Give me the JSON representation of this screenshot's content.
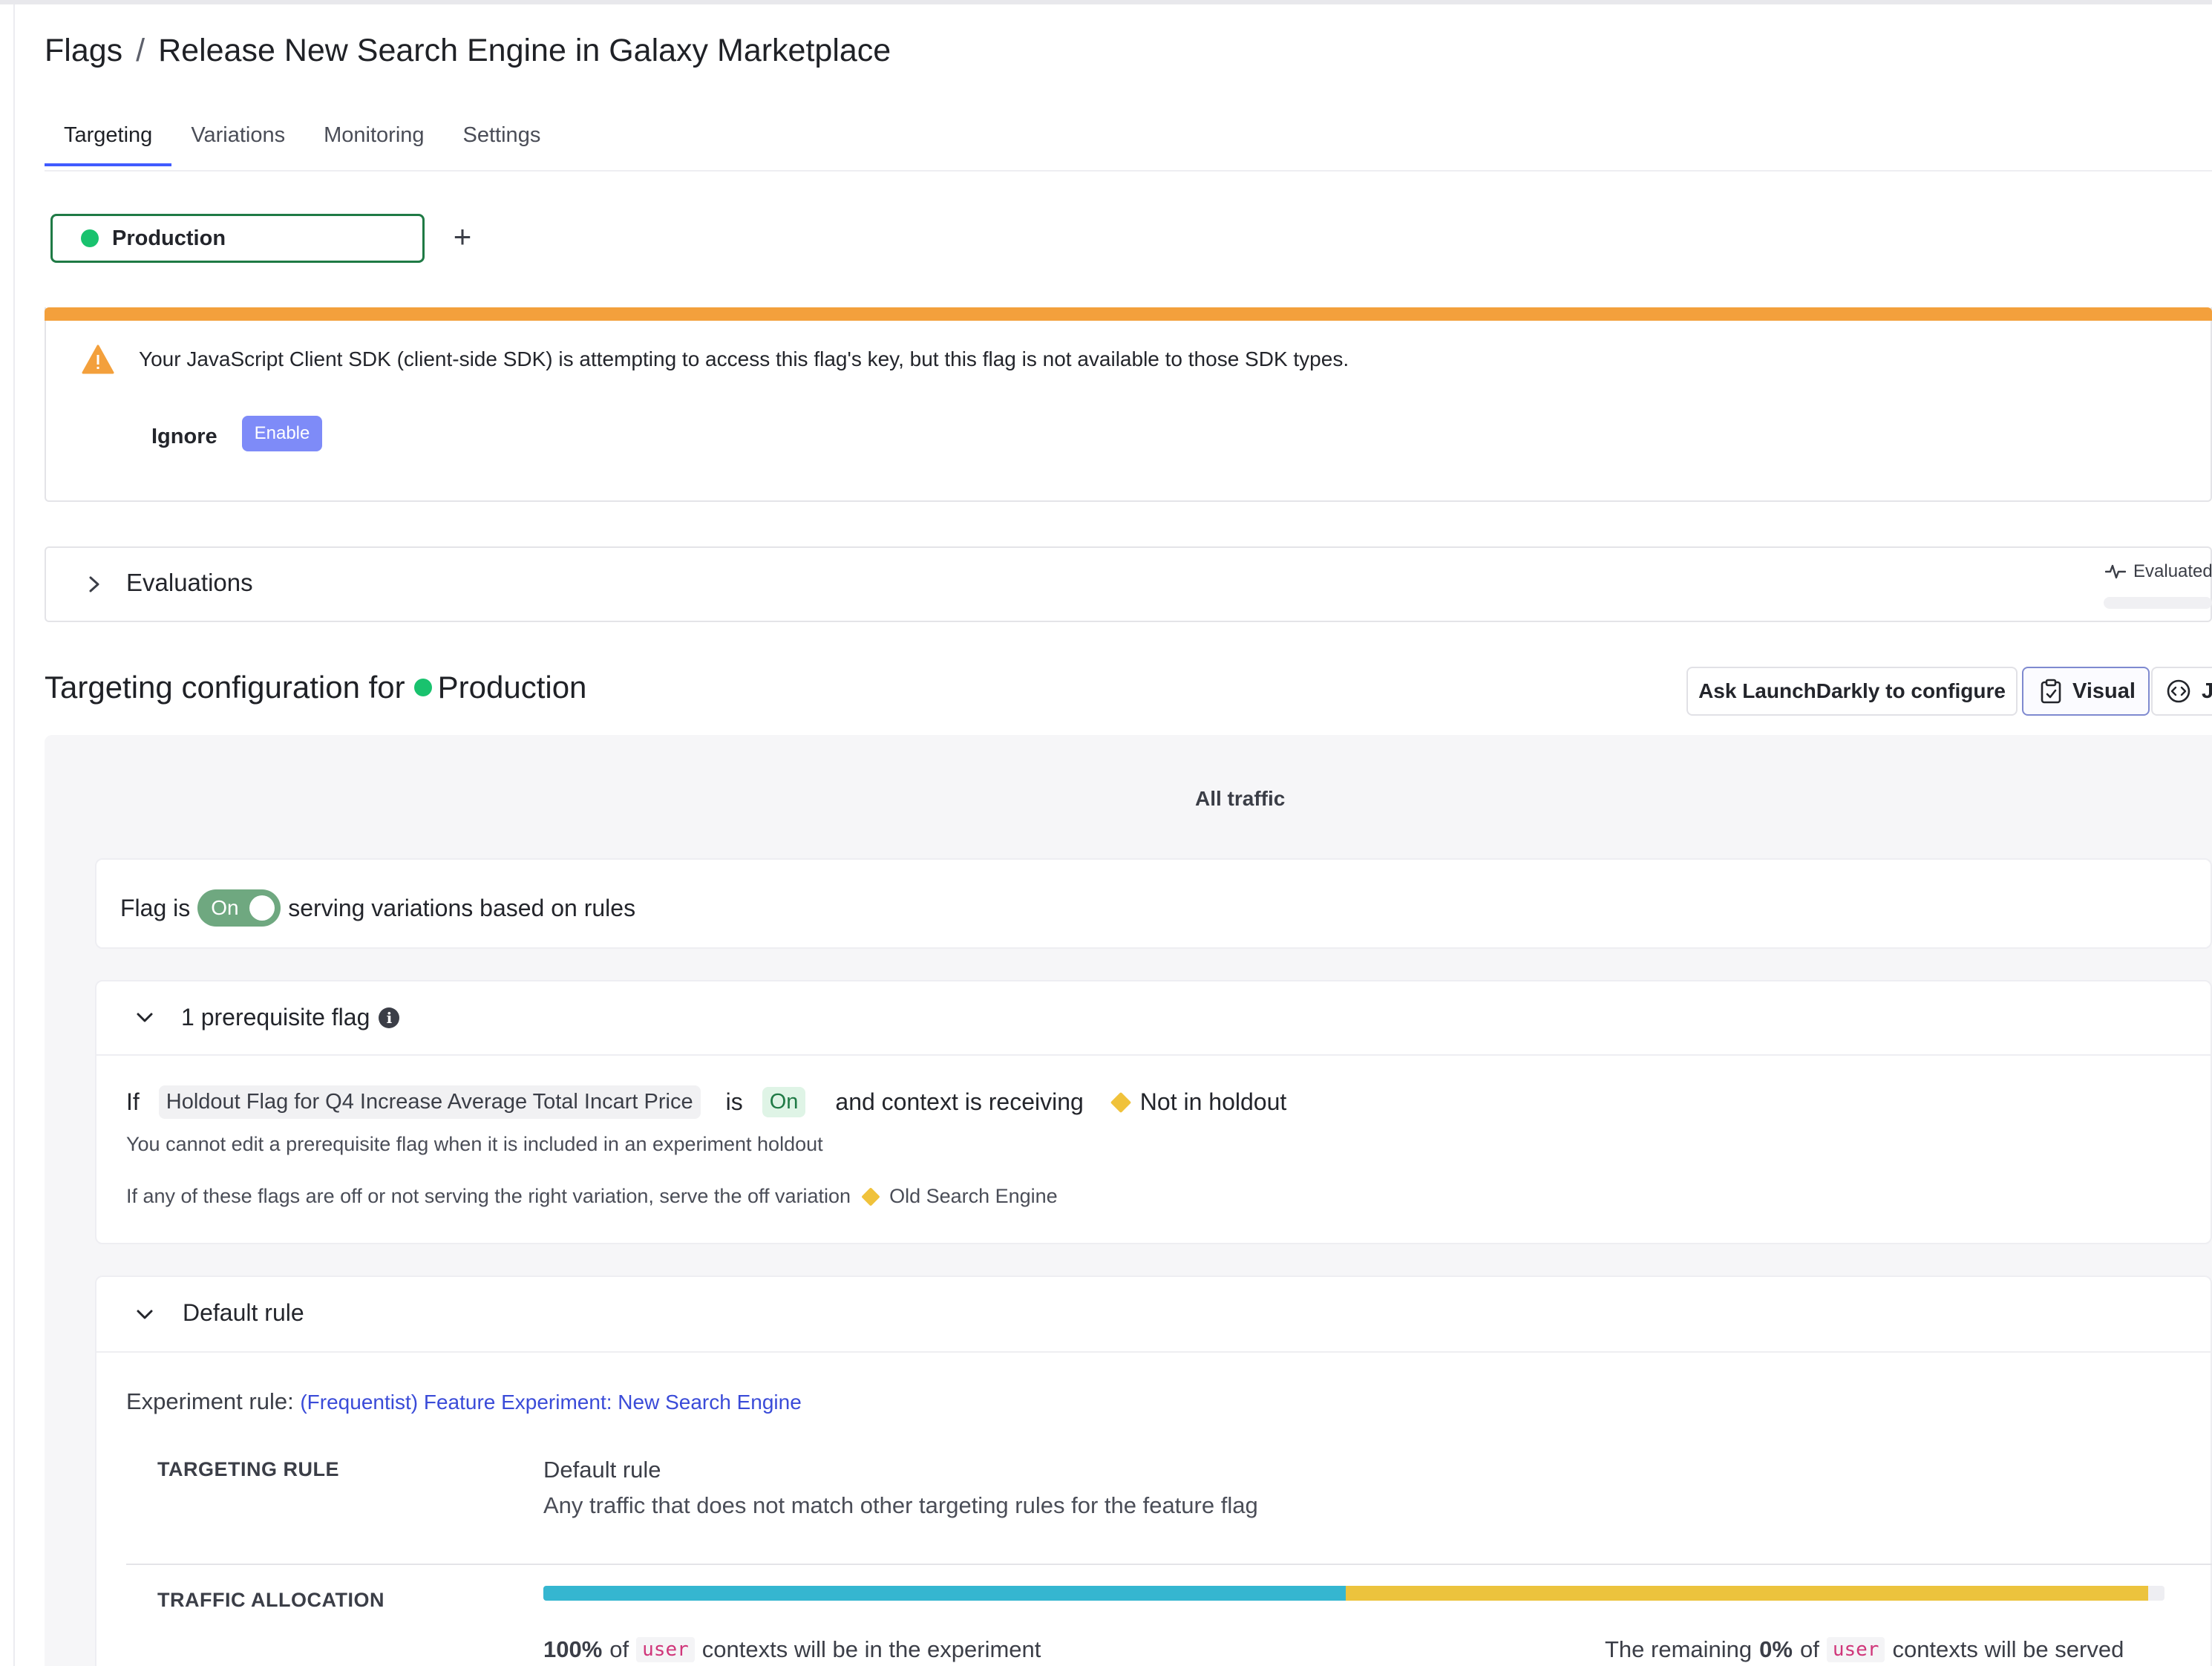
{
  "breadcrumb": {
    "root": "Flags",
    "separator": "/",
    "flag_name": "Release New Search Engine in Galaxy Marketplace"
  },
  "tabs": [
    {
      "label": "Targeting",
      "active": true
    },
    {
      "label": "Variations",
      "active": false
    },
    {
      "label": "Monitoring",
      "active": false
    },
    {
      "label": "Settings",
      "active": false
    }
  ],
  "environment": {
    "name": "Production",
    "color": "#19c26e",
    "add_label": "+"
  },
  "warning": {
    "message": "Your JavaScript Client SDK (client-side SDK) is attempting to access this flag's key, but this flag is not available to those SDK types.",
    "ignore_label": "Ignore",
    "enable_label": "Enable",
    "accent_color": "#f3a03c"
  },
  "evaluations": {
    "label": "Evaluations",
    "status": "Evaluated"
  },
  "targeting_config": {
    "title_prefix": "Targeting configuration for",
    "env_name": "Production",
    "ask_button": "Ask LaunchDarkly to configure",
    "visual_button": "Visual",
    "json_button": "JS"
  },
  "panel": {
    "all_traffic": "All traffic",
    "flag_status": {
      "prefix": "Flag is",
      "toggle_label": "On",
      "suffix": "serving variations based on rules"
    },
    "prerequisites": {
      "title": "1 prerequisite flag",
      "info_icon": "i",
      "if_label": "If",
      "flag_name": "Holdout Flag for Q4 Increase Average Total Incart Price",
      "is_label": "is",
      "state": "On",
      "receiving_label": "and context is receiving",
      "variation": "Not in holdout",
      "note": "You cannot edit a prerequisite flag when it is included in an experiment holdout",
      "off_note": "If any of these flags are off or not serving the right variation, serve the off variation",
      "off_variation": "Old Search Engine"
    },
    "default_rule": {
      "title": "Default rule",
      "experiment_label": "Experiment rule:",
      "experiment_link": "(Frequentist) Feature Experiment: New Search Engine",
      "targeting_rule_label": "TARGETING RULE",
      "rule_name": "Default rule",
      "rule_description": "Any traffic that does not match other targeting rules for the feature flag",
      "traffic_allocation_label": "TRAFFIC ALLOCATION",
      "allocation": {
        "segment_a_fraction": 0.5,
        "segment_b_fraction": 0.5,
        "color_a": "#35b6d0",
        "color_b": "#ecc33d"
      },
      "in_experiment_pct": "100%",
      "of_label": "of",
      "context_kind": "user",
      "in_experiment_suffix": "contexts will be in the experiment",
      "remaining_prefix": "The remaining",
      "remaining_pct": "0%",
      "remaining_suffix": "contexts will be served"
    }
  }
}
